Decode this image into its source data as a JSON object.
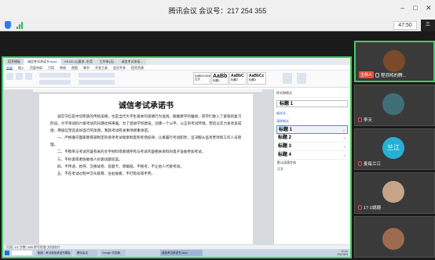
{
  "meeting": {
    "title": "腾讯会议 会议号：217 254 355",
    "timer": "47:50",
    "collapse_label": "三"
  },
  "wps": {
    "tabs": [
      "稻壳模板",
      "诚信考试承诺书.docx",
      "HSJ20 (1)要求..东莞",
      "工作单(无)",
      "诚信考试承诺..."
    ],
    "menu": [
      "开始",
      "插入",
      "页面布局",
      "引用",
      "审阅",
      "视图",
      "章节",
      "开发工具",
      "会员专享",
      "稻壳资源"
    ],
    "active_menu": "开始",
    "styles": [
      "AaBbCcDd",
      "AaBb",
      "AaBbC",
      "AaBbCc"
    ],
    "style_names": [
      "正文",
      "标题1",
      "标题2",
      "标题3"
    ]
  },
  "document": {
    "title": "诚信考试承诺书",
    "paragraphs": [
      "诚实守信是中华民族的传统美德，也是当代大学生基本的道德行为准则。随着教学的推进，同学们进入了紧张的复习阶段。大学英语四六级考试的日期也将来临，为了促进学风建设，创建一个公平、公正的考试环境，营造以实力争优良成绩、用诚信塑造良好品行的氛围，我就考试有关事项郑重承诺。",
      "一、严格遵守国家教育部制定的各项考试规章制度和考场纪律，认真履行考试职责，坚决服从监考老师和工作人员管理。",
      "二、不携带与考试内容有关的文字材料或者储存有与考试内容相关资料的电子设备参加考试。",
      "三、不抄袭或者协助他人抄袭试题答案。",
      "四、不传递、抢夺、交换试卷、答题卡、草稿纸，不替考，不让他人代替考试。",
      "五、不在考试过程中交头接耳、左右偷看，不打暗号或手势。"
    ],
    "status": "页面: 1/1  字数: 386  拼写检查  文档校对"
  },
  "panel": {
    "title": "样式和格式",
    "current": "标题 1",
    "new_style": "新样式...",
    "clear": "清除格式",
    "items": [
      "标题 1",
      "标题 2",
      "标题 3",
      "标题 4"
    ],
    "extra": [
      "默认段落字体",
      "正文"
    ]
  },
  "taskbar": {
    "items": [
      "稻壳 - 考试诚信承诺书模板",
      "腾讯会议",
      "Google 浏览器",
      "诚信考试承诺书.docx"
    ],
    "time": "10:11",
    "date": "2021/6/3"
  },
  "participants": [
    {
      "name": "程弥鸠的腾...",
      "host": "主持人",
      "muted": false,
      "avatar_color": "#7a4a2a"
    },
    {
      "name": "李天",
      "host": "",
      "muted": true,
      "avatar_color": "#3f6e79"
    },
    {
      "name": "麦每兰江",
      "host": "",
      "muted": true,
      "avatar_color": "#27b0d6",
      "avatar_text": "兰江"
    },
    {
      "name": "17-1姚珊",
      "host": "",
      "muted": true,
      "avatar_color": "#c5a48a"
    },
    {
      "name": "",
      "host": "",
      "muted": false,
      "avatar_color": "#9d6c4e"
    }
  ]
}
